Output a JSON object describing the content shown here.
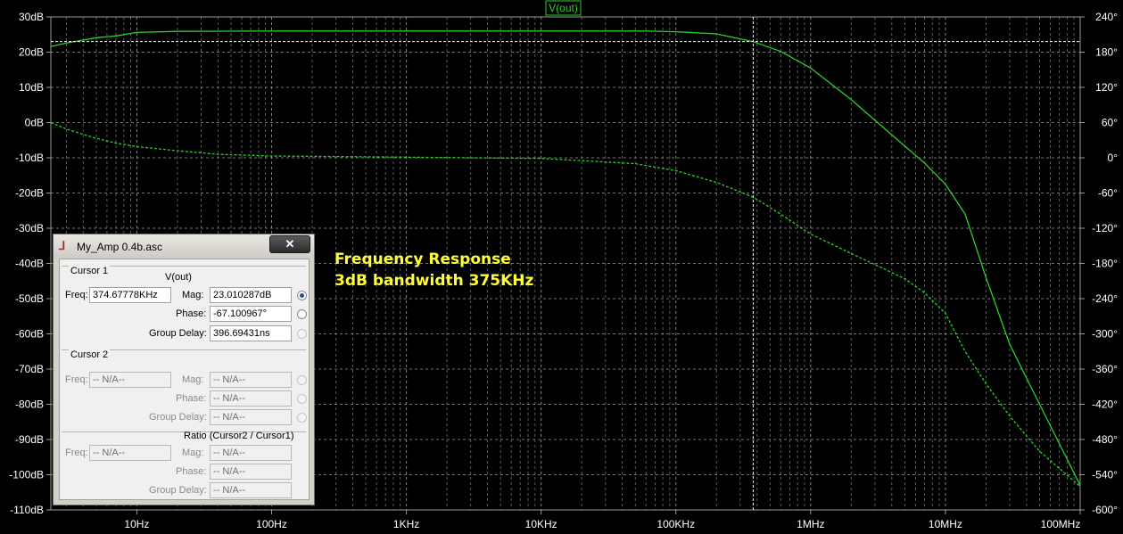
{
  "window": {
    "title": "My_Amp 0.4b.asc",
    "close_glyph": "✕",
    "cursor1": {
      "group_label": "Cursor 1",
      "trace": "V(out)",
      "freq_label": "Freq:",
      "freq_value": "374.67778KHz",
      "mag_label": "Mag:",
      "mag_value": "23.010287dB",
      "phase_label": "Phase:",
      "phase_value": "-67.100967°",
      "gd_label": "Group Delay:",
      "gd_value": "396.69431ns"
    },
    "cursor2": {
      "group_label": "Cursor 2",
      "freq_label": "Freq:",
      "freq_value": "-- N/A--",
      "mag_label": "Mag:",
      "mag_value": "-- N/A--",
      "phase_label": "Phase:",
      "phase_value": "-- N/A--",
      "gd_label": "Group Delay:",
      "gd_value": "-- N/A--"
    },
    "ratio": {
      "group_label": "Ratio (Cursor2 / Cursor1)",
      "freq_label": "Freq:",
      "freq_value": "-- N/A--",
      "mag_label": "Mag:",
      "mag_value": "-- N/A--",
      "phase_label": "Phase:",
      "phase_value": "-- N/A--",
      "gd_label": "Group Delay:",
      "gd_value": "-- N/A--"
    }
  },
  "annotation": {
    "line1": "Frequency Response",
    "line2": "3dB bandwidth 375KHz",
    "color": "#ffff33"
  },
  "chart_data": {
    "type": "line",
    "title": "V(out)",
    "xscale": "log",
    "xlim": [
      2.3,
      100000000
    ],
    "ylim": [
      -110,
      30
    ],
    "y2lim": [
      -600,
      240
    ],
    "grid": true,
    "colors": {
      "background": "#000000",
      "trace": "#2ad12a",
      "grid": "#9a9a9a",
      "text": "#ffffff"
    },
    "x_ticks": [
      {
        "value": 10,
        "label": "10Hz"
      },
      {
        "value": 100,
        "label": "100Hz"
      },
      {
        "value": 1000,
        "label": "1KHz"
      },
      {
        "value": 10000,
        "label": "10KHz"
      },
      {
        "value": 100000,
        "label": "100KHz"
      },
      {
        "value": 1000000,
        "label": "1MHz"
      },
      {
        "value": 10000000,
        "label": "10MHz"
      },
      {
        "value": 100000000,
        "label": "100MHz"
      }
    ],
    "y_ticks": [
      {
        "value": 30,
        "label": "30dB"
      },
      {
        "value": 20,
        "label": "20dB"
      },
      {
        "value": 10,
        "label": "10dB"
      },
      {
        "value": 0,
        "label": "0dB"
      },
      {
        "value": -10,
        "label": "-10dB"
      },
      {
        "value": -20,
        "label": "-20dB"
      },
      {
        "value": -30,
        "label": "-30dB"
      },
      {
        "value": -40,
        "label": "-40dB"
      },
      {
        "value": -50,
        "label": "-50dB"
      },
      {
        "value": -60,
        "label": "-60dB"
      },
      {
        "value": -70,
        "label": "-70dB"
      },
      {
        "value": -80,
        "label": "-80dB"
      },
      {
        "value": -90,
        "label": "-90dB"
      },
      {
        "value": -100,
        "label": "-100dB"
      },
      {
        "value": -110,
        "label": "-110dB"
      }
    ],
    "y2_ticks": [
      {
        "value": 240,
        "label": "240°"
      },
      {
        "value": 180,
        "label": "180°"
      },
      {
        "value": 120,
        "label": "120°"
      },
      {
        "value": 60,
        "label": "60°"
      },
      {
        "value": 0,
        "label": "0°"
      },
      {
        "value": -60,
        "label": "-60°"
      },
      {
        "value": -120,
        "label": "-120°"
      },
      {
        "value": -180,
        "label": "-180°"
      },
      {
        "value": -240,
        "label": "-240°"
      },
      {
        "value": -300,
        "label": "-300°"
      },
      {
        "value": -360,
        "label": "-360°"
      },
      {
        "value": -420,
        "label": "-420°"
      },
      {
        "value": -480,
        "label": "-480°"
      },
      {
        "value": -540,
        "label": "-540°"
      },
      {
        "value": -600,
        "label": "-600°"
      }
    ],
    "series": [
      {
        "name": "V(out)",
        "style": "solid",
        "axis": "y",
        "x": [
          2.3,
          3,
          5,
          7,
          10,
          20,
          100,
          1000,
          10000,
          60000,
          100000,
          200000,
          374678,
          600000,
          1000000,
          2000000,
          4000000,
          7000000,
          10000000,
          14000000,
          20000000,
          30000000,
          50000000,
          100000000
        ],
        "y": [
          21.6,
          22.6,
          24.1,
          24.6,
          25.6,
          25.9,
          26,
          26,
          26,
          26,
          25.8,
          25.2,
          23.0,
          20.2,
          15.5,
          6.5,
          -3.5,
          -11.5,
          -17.5,
          -26,
          -44,
          -63,
          -80,
          -103
        ]
      },
      {
        "name": "V(out) phase",
        "style": "dashed",
        "axis": "y2",
        "x": [
          2.3,
          3,
          5,
          7,
          10,
          20,
          40,
          100,
          1000,
          10000,
          50000,
          100000,
          200000,
          374678,
          600000,
          1000000,
          2000000,
          5000000,
          7000000,
          10000000,
          14000000,
          20000000,
          30000000,
          50000000,
          100000000
        ],
        "y": [
          60,
          49,
          33,
          25,
          19,
          12,
          6,
          3,
          1,
          -1,
          -10,
          -22,
          -42,
          -67,
          -96,
          -130,
          -163,
          -206,
          -230,
          -265,
          -330,
          -385,
          -440,
          -500,
          -560
        ]
      }
    ],
    "cursor": {
      "x": 374678,
      "y_db": 23.010287
    }
  }
}
